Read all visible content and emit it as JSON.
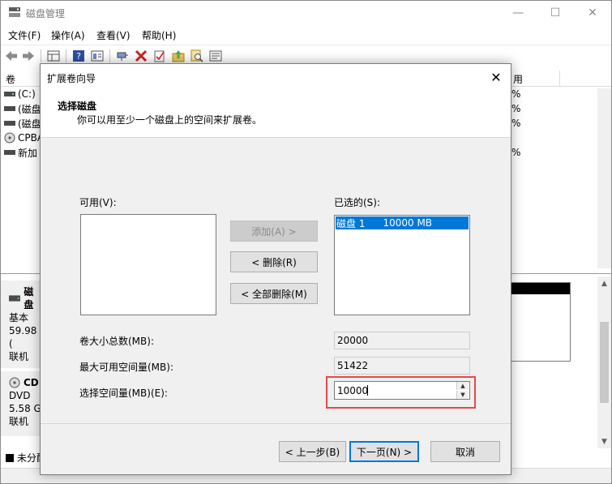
{
  "window": {
    "title": "磁盘管理",
    "controls": {
      "minimize": "—",
      "maximize": "☐",
      "close": "✕"
    }
  },
  "menu": [
    "文件(F)",
    "操作(A)",
    "查看(V)",
    "帮助(H)"
  ],
  "toolbar_icons": [
    "back-arrow-icon",
    "forward-arrow-icon",
    "grid-icon",
    "help-icon",
    "panel-icon",
    "connect-icon",
    "delete-x-icon",
    "check-doc-icon",
    "folder-up-icon",
    "search-doc-icon",
    "properties-icon"
  ],
  "volume_list": {
    "columns": [
      "卷",
      "用"
    ],
    "rows": [
      {
        "label": "(C:)",
        "pct": "%"
      },
      {
        "label": "(磁盘",
        "pct": "%"
      },
      {
        "label": "(磁盘",
        "pct": "%"
      },
      {
        "label": "CPBA",
        "pct": ""
      },
      {
        "label": "新加",
        "pct": "%"
      }
    ]
  },
  "disks": [
    {
      "name": "磁盘",
      "type": "基本",
      "size": "59.98 (",
      "status": "联机"
    },
    {
      "name": "CD",
      "type": "DVD",
      "size": "5.58 G",
      "status": "联机"
    }
  ],
  "legend": {
    "label": "未分配"
  },
  "dialog": {
    "title": "扩展卷向导",
    "close": "✕",
    "header_title": "选择磁盘",
    "header_subtitle": "你可以用至少一个磁盘上的空间来扩展卷。",
    "available_label": "可用(V):",
    "selected_label": "已选的(S):",
    "selected_items": [
      {
        "name": "磁盘 1",
        "size": "10000 MB"
      }
    ],
    "btn_add": "添加(A) >",
    "btn_remove": "< 删除(R)",
    "btn_remove_all": "< 全部删除(M)",
    "total_size_label": "卷大小总数(MB):",
    "total_size_value": "20000",
    "max_space_label": "最大可用空间量(MB):",
    "max_space_value": "51422",
    "select_space_label": "选择空间量(MB)(E):",
    "select_space_value": "10000",
    "btn_back": "< 上一步(B)",
    "btn_next": "下一页(N) >",
    "btn_cancel": "取消"
  },
  "colors": {
    "selection": "#0078d7",
    "highlight": "#e24b48"
  }
}
